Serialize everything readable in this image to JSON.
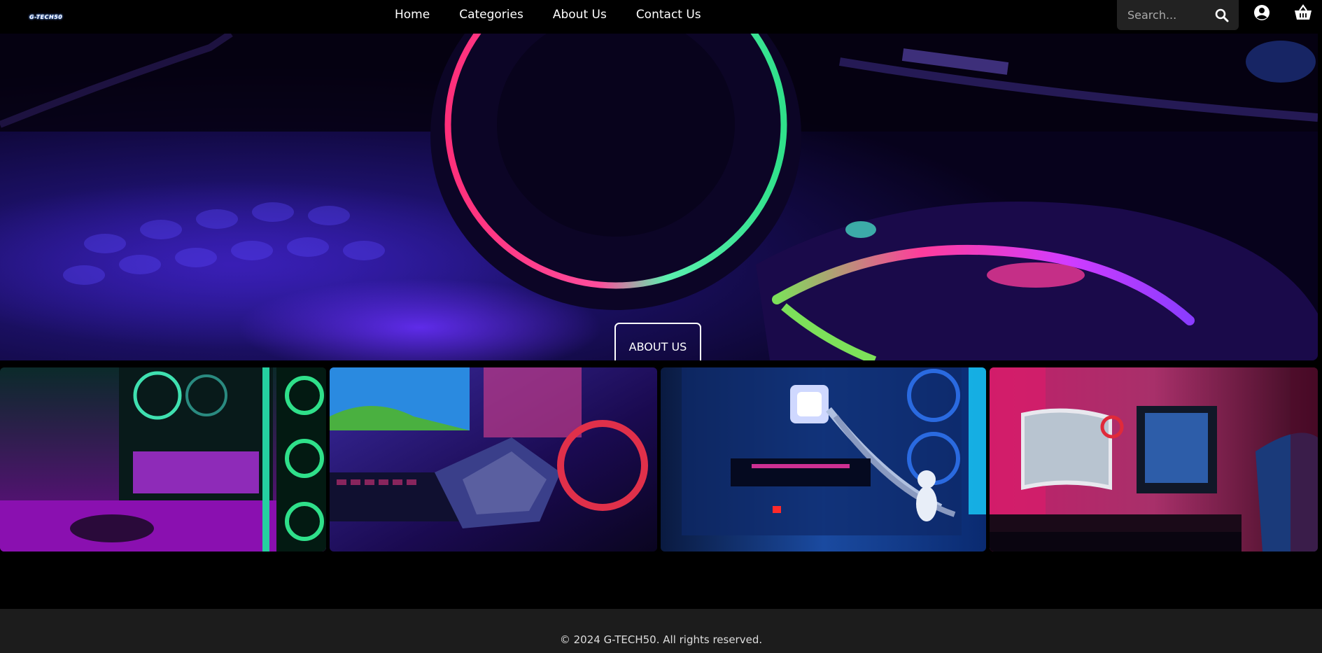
{
  "brand": {
    "logo_text": "G-TECH50"
  },
  "nav": {
    "items": [
      {
        "label": "Home"
      },
      {
        "label": "Categories"
      },
      {
        "label": "About Us"
      },
      {
        "label": "Contact Us"
      }
    ]
  },
  "search": {
    "placeholder": "Search...",
    "icon": "search-icon"
  },
  "header_icons": {
    "account": "user-circle-icon",
    "cart": "shopping-basket-icon"
  },
  "hero": {
    "cta_label": "ABOUT US",
    "image": "gaming-headset-keyboard-mouse-neon"
  },
  "gallery": {
    "images": [
      {
        "subject": "rgb-pc-case-controller"
      },
      {
        "subject": "gaming-headset-keyboard"
      },
      {
        "subject": "blue-pc-build-astronaut"
      },
      {
        "subject": "gaming-desk-curved-monitor"
      }
    ]
  },
  "footer": {
    "copyright": "© 2024 G-TECH50. All rights reserved."
  },
  "colors": {
    "background": "#000000",
    "footer_bg": "#1c1c1c",
    "search_bg": "#222222",
    "neon_pink": "#ff3c9c",
    "neon_green": "#3ff0a0",
    "neon_purple": "#8a2cff"
  }
}
